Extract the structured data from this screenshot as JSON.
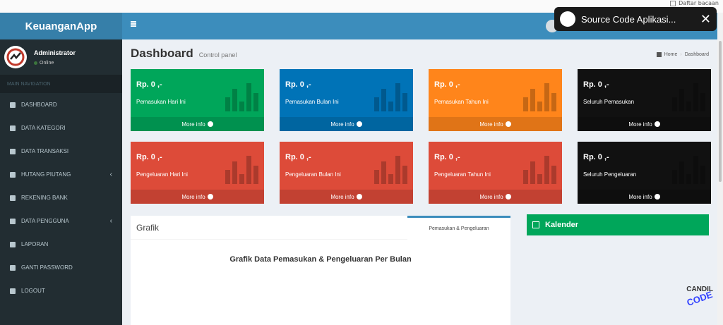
{
  "browser": {
    "bookmark_label": "Daftar bacaan"
  },
  "brand": {
    "name": "KeuanganApp"
  },
  "user": {
    "name": "Administrator",
    "status": "Online"
  },
  "sidebar": {
    "header": "MAIN NAVIGATION",
    "items": [
      {
        "label": "DASHBOARD",
        "icon": "dashboard-icon"
      },
      {
        "label": "DATA KATEGORI",
        "icon": "folder-icon"
      },
      {
        "label": "DATA TRANSAKSI",
        "icon": "folder-icon"
      },
      {
        "label": "HUTANG PIUTANG",
        "icon": "hand-icon",
        "caret": "‹"
      },
      {
        "label": "REKENING BANK",
        "icon": "bank-icon"
      },
      {
        "label": "DATA PENGGUNA",
        "icon": "users-icon",
        "caret": "‹"
      },
      {
        "label": "LAPORAN",
        "icon": "file-icon"
      },
      {
        "label": "GANTI PASSWORD",
        "icon": "lock-icon"
      },
      {
        "label": "LOGOUT",
        "icon": "sign-out-icon"
      }
    ]
  },
  "video": {
    "title": "Source Code Aplikasi...",
    "close": "✕"
  },
  "page": {
    "title": "Dashboard",
    "subtitle": "Control panel"
  },
  "breadcrumb": {
    "home": "Home",
    "current": "Dashboard"
  },
  "boxes": [
    {
      "amount": "Rp. 0 ,-",
      "label": "Pemasukan Hari Ini",
      "more": "More info",
      "color": "#00a65a"
    },
    {
      "amount": "Rp. 0 ,-",
      "label": "Pemasukan Bulan Ini",
      "more": "More info",
      "color": "#0073b7"
    },
    {
      "amount": "Rp. 0 ,-",
      "label": "Pemasukan Tahun Ini",
      "more": "More info",
      "color": "#ff851b"
    },
    {
      "amount": "Rp. 0 ,-",
      "label": "Seluruh Pemasukan",
      "more": "More info",
      "color": "#111111"
    },
    {
      "amount": "Rp. 0 ,-",
      "label": "Pengeluaran Hari Ini",
      "more": "More info",
      "color": "#dd4b39"
    },
    {
      "amount": "Rp. 0 ,-",
      "label": "Pengeluaran Bulan Ini",
      "more": "More info",
      "color": "#dd4b39"
    },
    {
      "amount": "Rp. 0 ,-",
      "label": "Pengeluaran Tahun Ini",
      "more": "More info",
      "color": "#dd4b39"
    },
    {
      "amount": "Rp. 0 ,-",
      "label": "Seluruh Pengeluaran",
      "more": "More info",
      "color": "#111111"
    }
  ],
  "grafik": {
    "title": "Grafik",
    "tab": "Pemasukan & Pengeluaran",
    "chart_title": "Grafik Data Pemasukan & Pengeluaran Per Bulan"
  },
  "kalender": {
    "title": "Kalender"
  },
  "watermark": {
    "line1": "CANDIL",
    "line2": "CODE"
  }
}
